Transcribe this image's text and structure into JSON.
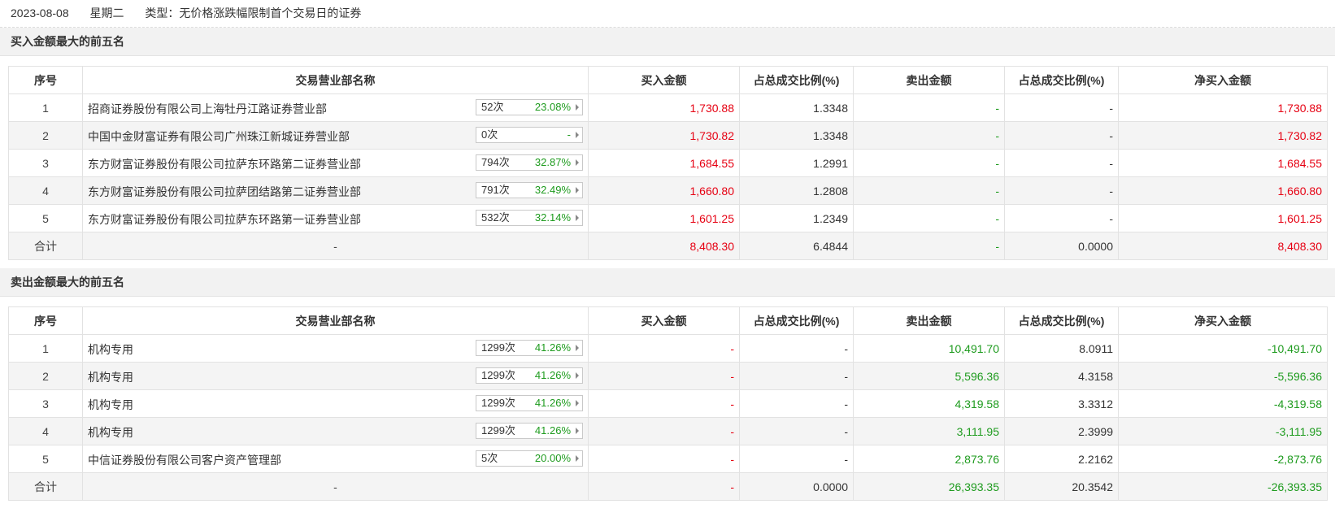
{
  "header": {
    "date": "2023-08-08",
    "weekday": "星期二",
    "type_text": "类型：无价格涨跌幅限制首个交易日的证券"
  },
  "columns": [
    "序号",
    "交易营业部名称",
    "买入金额",
    "占总成交比例(%)",
    "卖出金额",
    "占总成交比例(%)",
    "净买入金额"
  ],
  "buy_section": {
    "title": "买入金额最大的前五名",
    "rows": [
      {
        "idx": "1",
        "name": "招商证券股份有限公司上海牡丹江路证券营业部",
        "count": "52次",
        "pct": "23.08%",
        "buy": "1,730.88",
        "buy_ratio": "1.3348",
        "sell": "-",
        "sell_ratio": "-",
        "net": "1,730.88"
      },
      {
        "idx": "2",
        "name": "中国中金财富证券有限公司广州珠江新城证券营业部",
        "count": "0次",
        "pct": "-",
        "buy": "1,730.82",
        "buy_ratio": "1.3348",
        "sell": "-",
        "sell_ratio": "-",
        "net": "1,730.82"
      },
      {
        "idx": "3",
        "name": "东方财富证券股份有限公司拉萨东环路第二证券营业部",
        "count": "794次",
        "pct": "32.87%",
        "buy": "1,684.55",
        "buy_ratio": "1.2991",
        "sell": "-",
        "sell_ratio": "-",
        "net": "1,684.55"
      },
      {
        "idx": "4",
        "name": "东方财富证券股份有限公司拉萨团结路第二证券营业部",
        "count": "791次",
        "pct": "32.49%",
        "buy": "1,660.80",
        "buy_ratio": "1.2808",
        "sell": "-",
        "sell_ratio": "-",
        "net": "1,660.80"
      },
      {
        "idx": "5",
        "name": "东方财富证券股份有限公司拉萨东环路第一证券营业部",
        "count": "532次",
        "pct": "32.14%",
        "buy": "1,601.25",
        "buy_ratio": "1.2349",
        "sell": "-",
        "sell_ratio": "-",
        "net": "1,601.25"
      }
    ],
    "total": {
      "label": "合计",
      "name": "-",
      "buy": "8,408.30",
      "buy_ratio": "6.4844",
      "sell": "-",
      "sell_ratio": "0.0000",
      "net": "8,408.30"
    }
  },
  "sell_section": {
    "title": "卖出金额最大的前五名",
    "rows": [
      {
        "idx": "1",
        "name": "机构专用",
        "count": "1299次",
        "pct": "41.26%",
        "buy": "-",
        "buy_ratio": "-",
        "sell": "10,491.70",
        "sell_ratio": "8.0911",
        "net": "-10,491.70"
      },
      {
        "idx": "2",
        "name": "机构专用",
        "count": "1299次",
        "pct": "41.26%",
        "buy": "-",
        "buy_ratio": "-",
        "sell": "5,596.36",
        "sell_ratio": "4.3158",
        "net": "-5,596.36"
      },
      {
        "idx": "3",
        "name": "机构专用",
        "count": "1299次",
        "pct": "41.26%",
        "buy": "-",
        "buy_ratio": "-",
        "sell": "4,319.58",
        "sell_ratio": "3.3312",
        "net": "-4,319.58"
      },
      {
        "idx": "4",
        "name": "机构专用",
        "count": "1299次",
        "pct": "41.26%",
        "buy": "-",
        "buy_ratio": "-",
        "sell": "3,111.95",
        "sell_ratio": "2.3999",
        "net": "-3,111.95"
      },
      {
        "idx": "5",
        "name": "中信证券股份有限公司客户资产管理部",
        "count": "5次",
        "pct": "20.00%",
        "buy": "-",
        "buy_ratio": "-",
        "sell": "2,873.76",
        "sell_ratio": "2.2162",
        "net": "-2,873.76"
      }
    ],
    "total": {
      "label": "合计",
      "name": "-",
      "buy": "-",
      "buy_ratio": "0.0000",
      "sell": "26,393.35",
      "sell_ratio": "20.3542",
      "net": "-26,393.35"
    }
  },
  "colors": {
    "red": "#e60012",
    "green": "#1e9b1e"
  }
}
